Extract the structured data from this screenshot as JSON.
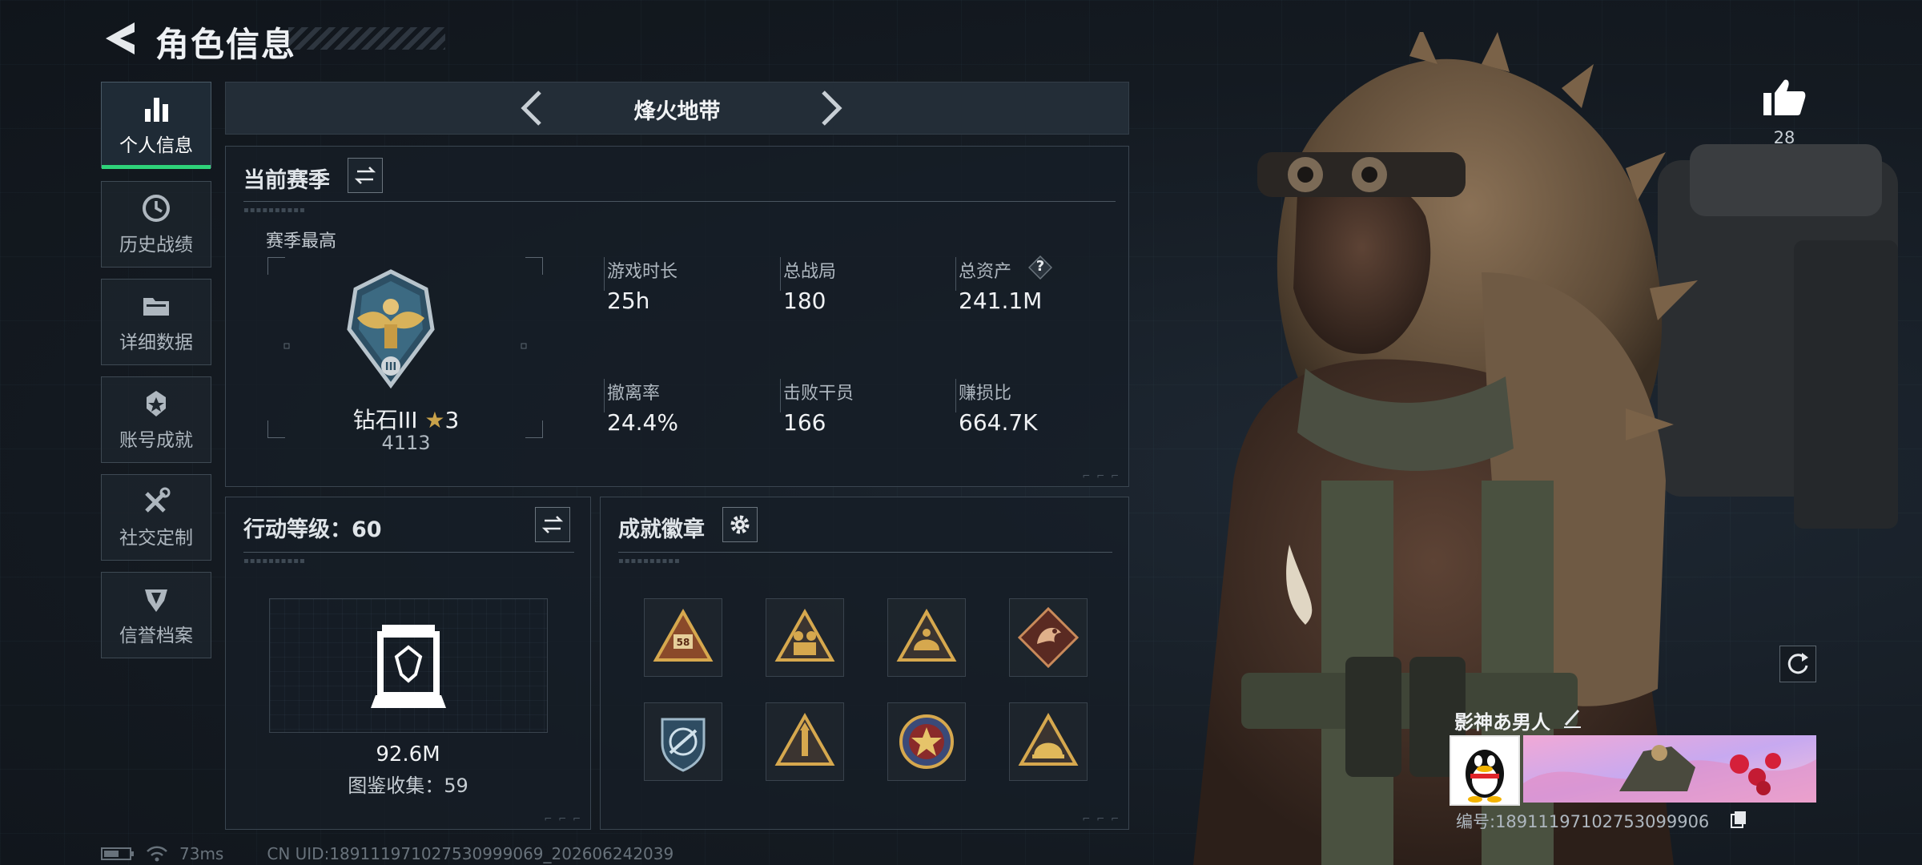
{
  "header": {
    "title": "角色信息"
  },
  "sidebar": {
    "items": [
      {
        "label": "个人信息",
        "icon": "bar-chart-icon",
        "active": true
      },
      {
        "label": "历史战绩",
        "icon": "history-clock-icon",
        "active": false
      },
      {
        "label": "详细数据",
        "icon": "folder-icon",
        "active": false
      },
      {
        "label": "账号成就",
        "icon": "medal-icon",
        "active": false
      },
      {
        "label": "社交定制",
        "icon": "wrench-tools-icon",
        "active": false
      },
      {
        "label": "信誉档案",
        "icon": "shield-emblem-icon",
        "active": false
      }
    ]
  },
  "mode": {
    "title": "烽火地带"
  },
  "season": {
    "title": "当前赛季",
    "best_label": "赛季最高",
    "rank_name": "钻石III",
    "rank_stars": "3",
    "rank_score": "4113",
    "stats": [
      {
        "label": "游戏时长",
        "value": "25h"
      },
      {
        "label": "总战局",
        "value": "180"
      },
      {
        "label": "总资产",
        "value": "241.1M"
      },
      {
        "label": "撤离率",
        "value": "24.4%"
      },
      {
        "label": "击败干员",
        "value": "166"
      },
      {
        "label": "赚损比",
        "value": "664.7K"
      }
    ],
    "help_mark": "?"
  },
  "level": {
    "title": "行动等级：60",
    "value": "92.6M",
    "collection": "图鉴收集：59"
  },
  "achievements": {
    "title": "成就徽章",
    "badges": [
      {
        "icon": "rank-58-badge-icon",
        "text": "58"
      },
      {
        "icon": "soldiers-badge-icon"
      },
      {
        "icon": "helmet-badge-icon"
      },
      {
        "icon": "dragon-badge-icon"
      },
      {
        "icon": "shield-weapon-badge-icon"
      },
      {
        "icon": "rocket-badge-icon"
      },
      {
        "icon": "star-medal-badge-icon"
      },
      {
        "icon": "helmet-gold-badge-icon"
      }
    ]
  },
  "profile": {
    "likes": "28",
    "name": "影神あ男人",
    "id_text": "编号:18911197102753099906"
  },
  "footer": {
    "ping": "73ms",
    "uid": "CN UID:18911197102753099906​9_202606242039"
  },
  "colors": {
    "accent": "#2ed37a",
    "panel_border": "#3a4550",
    "gold": "#c9a24a"
  }
}
